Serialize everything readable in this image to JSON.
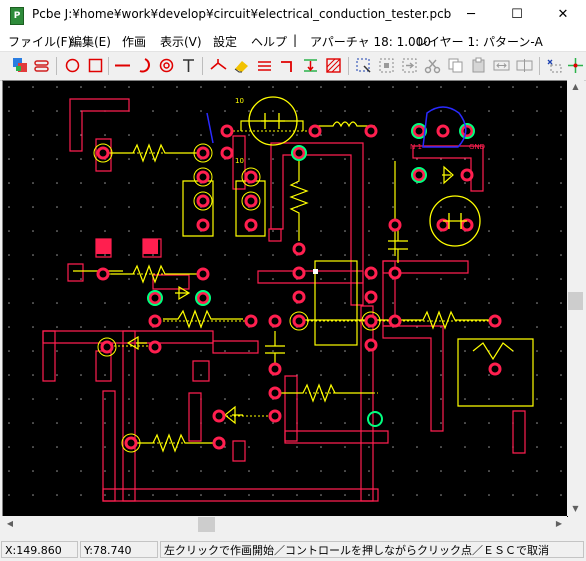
{
  "window": {
    "title": "Pcbe J:¥home¥work¥develop¥circuit¥electrical_conduction_tester.pcb",
    "app_icon_letter": "P",
    "minimize_glyph": "─",
    "maximize_glyph": "☐",
    "close_glyph": "✕"
  },
  "menu": {
    "file": "ファイル(F)",
    "edit": "編集(E)",
    "draw": "作画",
    "view": "表示(V)",
    "settings": "設定",
    "help": "ヘルプ",
    "separator": "|",
    "aperture": "アパーチャ 18: 1.000",
    "layer": "レイヤー 1: パターン-A"
  },
  "toolbar": {
    "tools": [
      "layer-color-icon",
      "layer-toggle-icon",
      "circle-icon",
      "rectangle-icon",
      "line-icon",
      "arc-icon",
      "target-icon",
      "text-icon",
      "junction-icon",
      "eraser-icon",
      "parallel-lines-icon",
      "bend-icon",
      "align-icon",
      "hatch-icon",
      "select-area-icon",
      "rotate-select-icon",
      "move-select-icon",
      "cut-icon",
      "copy-icon",
      "paste-icon",
      "mirror-icon",
      "flip-icon",
      "lasso-icon",
      "crosshair-icon"
    ]
  },
  "board": {
    "labels": {
      "n1": "N 1",
      "gnd": "GND",
      "top1": "10",
      "top2": "10"
    },
    "colors": {
      "background": "#000000",
      "pad": "#ff1f4f",
      "copper_text": "#ffff00",
      "highlight": "#00ff7f",
      "silk_blue": "#2222ff",
      "grid": "#9a9a9a"
    }
  },
  "status": {
    "x": "X:149.860",
    "y": "Y:78.740",
    "message": "左クリックで作画開始／コントロールを押しながらクリック点／ＥＳＣで取消"
  }
}
